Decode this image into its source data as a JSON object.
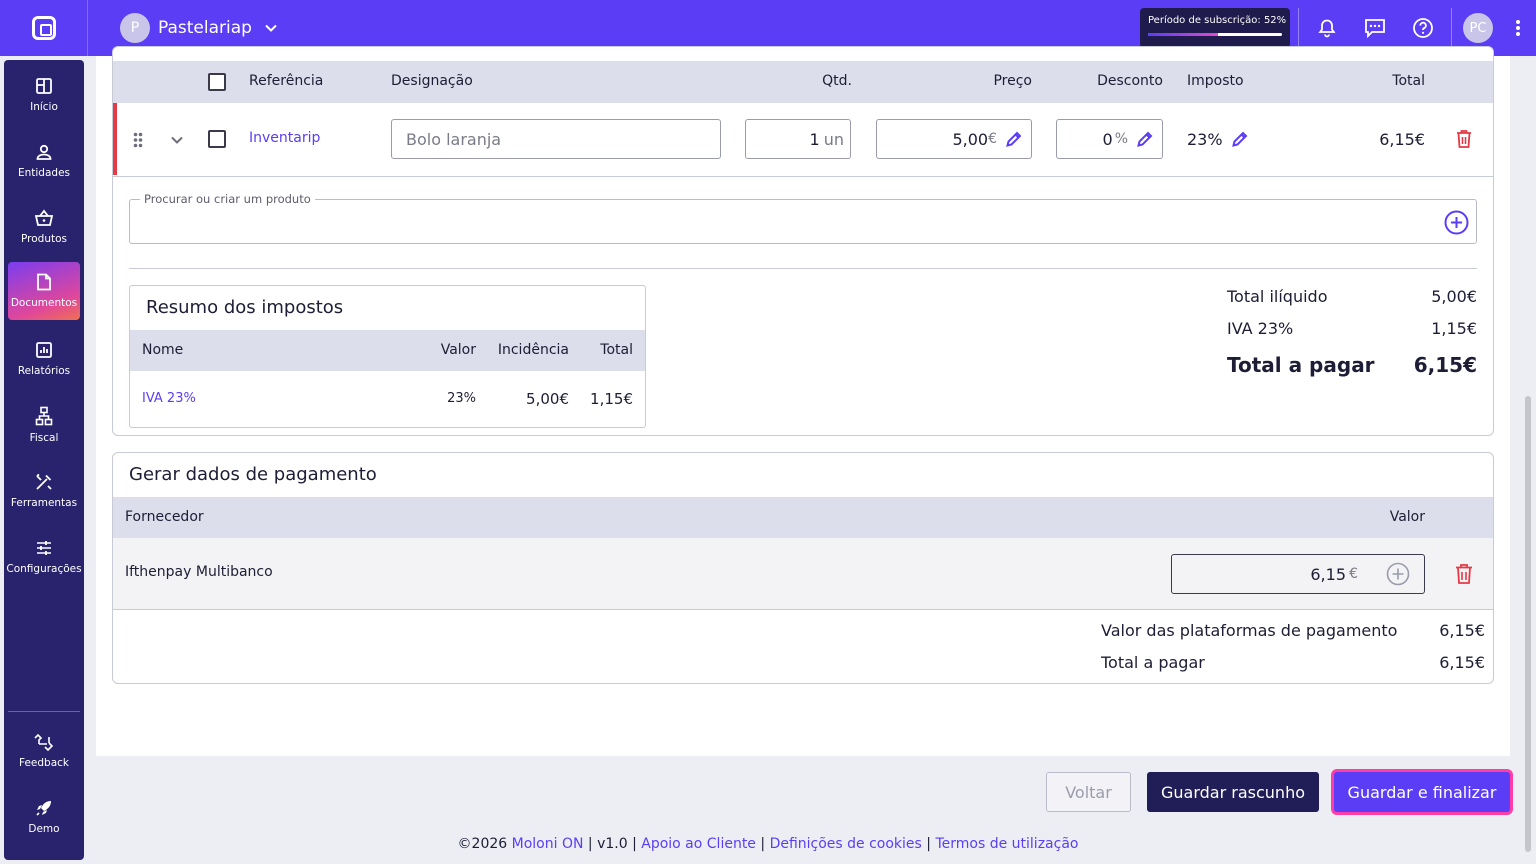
{
  "header": {
    "company_initial": "P",
    "company_name": "Pastelariap",
    "subscription_label": "Período de subscrição: 52%",
    "subscription_progress": 52,
    "user_initials": "PC"
  },
  "sidebar": {
    "items": [
      {
        "label": "Início",
        "icon": "home-icon"
      },
      {
        "label": "Entidades",
        "icon": "user-icon"
      },
      {
        "label": "Produtos",
        "icon": "basket-icon"
      },
      {
        "label": "Documentos",
        "icon": "document-icon",
        "active": true
      },
      {
        "label": "Relatórios",
        "icon": "chart-icon"
      },
      {
        "label": "Fiscal",
        "icon": "network-icon"
      },
      {
        "label": "Ferramentas",
        "icon": "tools-icon"
      },
      {
        "label": "Configurações",
        "icon": "sliders-icon"
      }
    ],
    "bottom": [
      {
        "label": "Feedback",
        "icon": "feedback-icon"
      },
      {
        "label": "Demo",
        "icon": "rocket-icon"
      }
    ]
  },
  "lines": {
    "headers": {
      "reference": "Referência",
      "designation": "Designação",
      "qty": "Qtd.",
      "price": "Preço",
      "discount": "Desconto",
      "tax": "Imposto",
      "total": "Total"
    },
    "row": {
      "reference": "Inventarip",
      "designation": "Bolo laranja",
      "qty": "1",
      "qty_unit": "un",
      "price": "5,00",
      "currency": "€",
      "discount": "0",
      "discount_unit": "%",
      "tax": "23%",
      "total": "6,15€"
    }
  },
  "search": {
    "label": "Procurar ou criar um produto"
  },
  "tax_summary": {
    "title": "Resumo dos impostos",
    "headers": {
      "name": "Nome",
      "value": "Valor",
      "incidence": "Incidência",
      "total": "Total"
    },
    "row": {
      "name": "IVA 23%",
      "value": "23%",
      "incidence": "5,00€",
      "total": "1,15€"
    }
  },
  "totals": {
    "net_label": "Total ilíquido",
    "net_value": "5,00€",
    "vat_label": "IVA 23%",
    "vat_value": "1,15€",
    "pay_label": "Total a pagar",
    "pay_value": "6,15€"
  },
  "payment": {
    "title": "Gerar dados de pagamento",
    "headers": {
      "provider": "Fornecedor",
      "value": "Valor"
    },
    "row": {
      "provider": "Ifthenpay Multibanco",
      "value": "6,15",
      "currency": "€"
    },
    "platforms_label": "Valor das plataformas de pagamento",
    "platforms_value": "6,15€",
    "total_label": "Total a pagar",
    "total_value": "6,15€"
  },
  "actions": {
    "back": "Voltar",
    "draft": "Guardar rascunho",
    "finalize": "Guardar e finalizar"
  },
  "footer": {
    "copyright": "©2026",
    "brand": "Moloni ON",
    "version": "v1.0",
    "support": "Apoio ao Cliente",
    "cookies": "Definições de cookies",
    "terms": "Termos de utilização"
  },
  "colors": {
    "primary": "#5b3df5",
    "sidebar": "#29236e",
    "danger": "#e53945",
    "dark_button": "#211d57",
    "highlight": "#ff3da8"
  }
}
